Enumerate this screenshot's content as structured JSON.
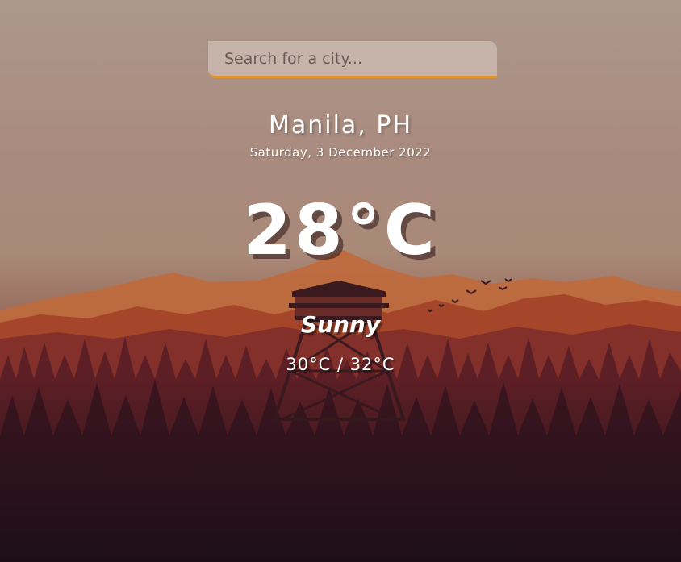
{
  "search": {
    "placeholder": "Search for a city...",
    "value": ""
  },
  "weather": {
    "location": "Manila, PH",
    "date": "Saturday, 3 December 2022",
    "temperature": "28°C",
    "condition": "Sunny",
    "high_low": "30°C / 32°C"
  },
  "colors": {
    "accent": "#e0952a",
    "text": "#ffffff",
    "sky": "#ad978c",
    "forest": "#2a1420"
  }
}
